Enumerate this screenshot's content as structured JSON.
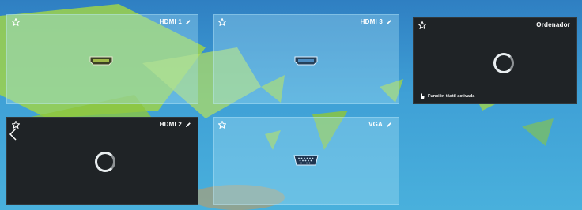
{
  "sources": [
    {
      "id": "hdmi1",
      "label": "HDMI 1",
      "editable": true,
      "state": "thumbnail",
      "port": "hdmi-port-icon"
    },
    {
      "id": "hdmi3",
      "label": "HDMI 3",
      "editable": true,
      "state": "thumbnail",
      "port": "hdmi-port-icon"
    },
    {
      "id": "computer",
      "label": "Ordenador",
      "editable": false,
      "state": "loading",
      "note": "Función táctil activada"
    },
    {
      "id": "hdmi2",
      "label": "HDMI 2",
      "editable": true,
      "state": "loading"
    },
    {
      "id": "vga",
      "label": "VGA",
      "editable": true,
      "state": "thumbnail",
      "port": "vga-port-icon"
    }
  ],
  "colors": {
    "background": "#3fa0d6",
    "accent_green": "#9fd34a",
    "dark_tile": "#1f2326",
    "text": "#ffffff"
  }
}
